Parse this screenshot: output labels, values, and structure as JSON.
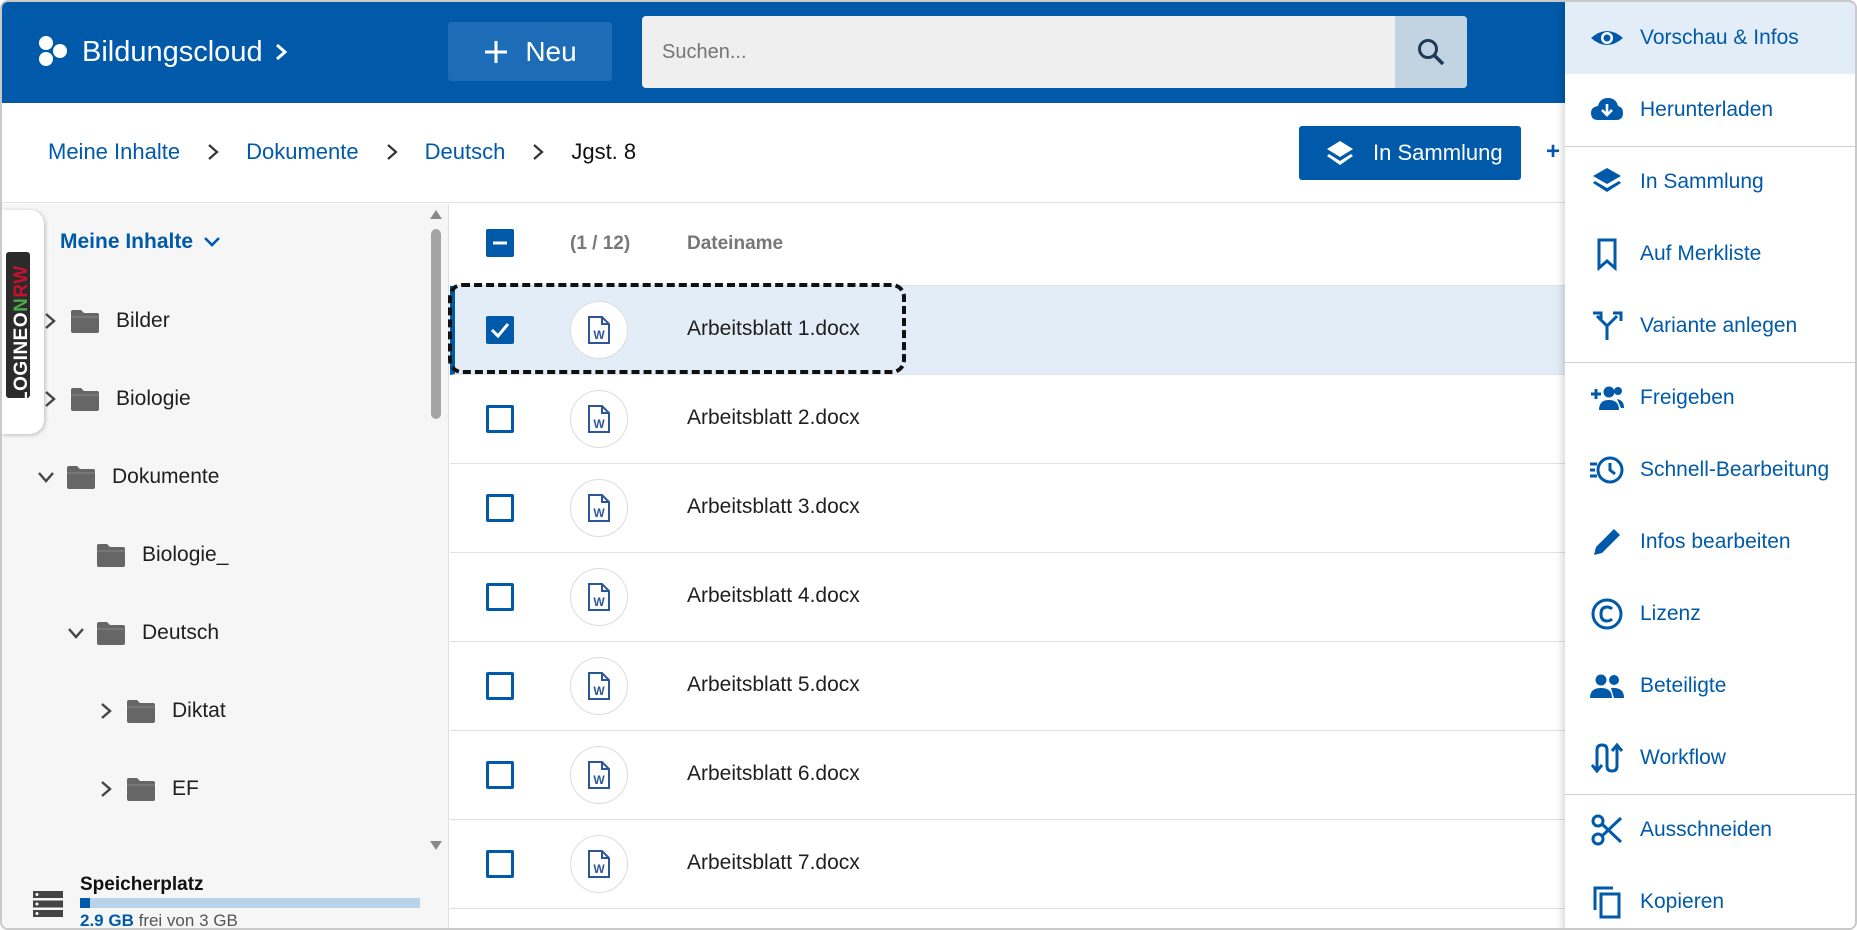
{
  "header": {
    "brand": "Bildungscloud",
    "new_label": "Neu",
    "search_placeholder": "Suchen..."
  },
  "breadcrumb": {
    "items": [
      "Meine Inhalte",
      "Dokumente",
      "Deutsch",
      "Jgst. 8"
    ]
  },
  "toolbar": {
    "collection_label": "In Sammlung",
    "share_stub": "+"
  },
  "sidebar": {
    "badge": {
      "part1": "LOGINEO",
      "part2": "N",
      "part3": "RW"
    },
    "root_label": "Meine Inhalte",
    "tree": [
      {
        "label": "Bilder",
        "state": "collapsed"
      },
      {
        "label": "Biologie",
        "state": "collapsed"
      },
      {
        "label": "Dokumente",
        "state": "expanded"
      },
      {
        "label": "Biologie_",
        "state": "leaf"
      },
      {
        "label": "Deutsch",
        "state": "expanded"
      },
      {
        "label": "Diktat",
        "state": "collapsed"
      },
      {
        "label": "EF",
        "state": "collapsed"
      }
    ],
    "storage": {
      "title": "Speicherplatz",
      "free_value": "2.9 GB",
      "free_text": "frei von 3 GB",
      "used_fraction": 0.03
    }
  },
  "files": {
    "count": "(1 / 12)",
    "column_name": "Dateiname",
    "rows": [
      {
        "name": "Arbeitsblatt 1.docx",
        "selected": true
      },
      {
        "name": "Arbeitsblatt 2.docx",
        "selected": false
      },
      {
        "name": "Arbeitsblatt 3.docx",
        "selected": false
      },
      {
        "name": "Arbeitsblatt 4.docx",
        "selected": false
      },
      {
        "name": "Arbeitsblatt 5.docx",
        "selected": false
      },
      {
        "name": "Arbeitsblatt 6.docx",
        "selected": false
      },
      {
        "name": "Arbeitsblatt 7.docx",
        "selected": false
      }
    ]
  },
  "menu": {
    "items": [
      {
        "label": "Vorschau & Infos",
        "icon": "eye-icon"
      },
      {
        "label": "Herunterladen",
        "icon": "cloud-download-icon"
      },
      {
        "label": "In Sammlung",
        "icon": "layers-icon"
      },
      {
        "label": "Auf Merkliste",
        "icon": "bookmark-icon"
      },
      {
        "label": "Variante anlegen",
        "icon": "fork-icon"
      },
      {
        "label": "Freigeben",
        "icon": "share-user-icon"
      },
      {
        "label": "Schnell-Bearbeitung",
        "icon": "quick-edit-icon"
      },
      {
        "label": "Infos bearbeiten",
        "icon": "pencil-icon"
      },
      {
        "label": "Lizenz",
        "icon": "copyright-icon"
      },
      {
        "label": "Beteiligte",
        "icon": "people-icon"
      },
      {
        "label": "Workflow",
        "icon": "workflow-icon"
      },
      {
        "label": "Ausschneiden",
        "icon": "scissors-icon"
      },
      {
        "label": "Kopieren",
        "icon": "copy-icon"
      }
    ]
  }
}
